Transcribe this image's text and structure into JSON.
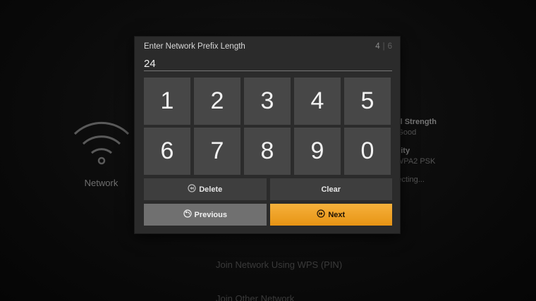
{
  "background": {
    "network_label": "Network",
    "info": [
      {
        "heading": "ignal Strength",
        "value": "ery Good"
      },
      {
        "heading": "ecurity",
        "value": "PA/WPA2 PSK"
      },
      {
        "heading": "",
        "value": "onnecting..."
      }
    ],
    "menu_items": [
      "Join Network Using WPS (PIN)",
      "Join Other Network"
    ]
  },
  "dialog": {
    "title": "Enter Network Prefix Length",
    "step_current": "4",
    "step_separator": "|",
    "step_total": "6",
    "input_value": "24",
    "keys": [
      "1",
      "2",
      "3",
      "4",
      "5",
      "6",
      "7",
      "8",
      "9",
      "0"
    ],
    "delete_label": "Delete",
    "clear_label": "Clear",
    "previous_label": "Previous",
    "next_label": "Next"
  },
  "colors": {
    "accent": "#f0a22a",
    "dialog_bg": "#2b2b2b",
    "key_bg": "#474747"
  },
  "icons": {
    "delete": "rewind-circle-icon",
    "previous": "back-circle-icon",
    "next": "forward-circle-icon",
    "wifi": "wifi-icon"
  }
}
